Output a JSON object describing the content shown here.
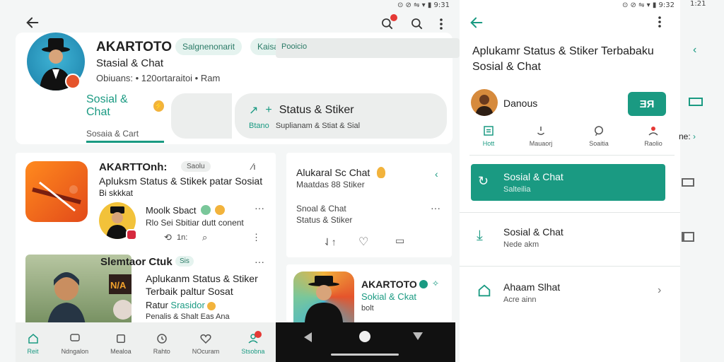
{
  "status_left": "⊙ ⊘ ⇋ ▾ ▮ 9:31",
  "status_right": "⊙ ⊘ ⇋ ▾ ▮ 9:32",
  "status_far": "1:21",
  "profile": {
    "name": "AKARTOTO",
    "category": "Stasial & Chat",
    "meta": "Obiuans: • 120ortaraitoi • Ram",
    "chip1": "Salgnenonarit",
    "chip2": "Kaisa",
    "chip3": "Pooicio"
  },
  "tabs": {
    "left_label": "Sosial & Chat",
    "left_sub": "Sosaia & Cart",
    "right_label": "Status & Stiker",
    "right_sub1": "Btano",
    "right_sub2": "Suplianam & Stiat & Sial"
  },
  "feed": {
    "item1_title": "AKARTTOnh:",
    "item1_chip": "Saolu",
    "item1_desc": "Apluksm Status & Stikek patar Sosiat",
    "item1_sub": "Bi skkkat",
    "item1_author": "Moolk Sbact",
    "item1_author_sub": "Rlo Sei Sbitiar dutt conent",
    "item1_reply": "1n:",
    "item2_title": "Slemtaor Ctuk",
    "item2_chip": "Sis",
    "item2_desc1": "Aplukanm Status & Stiker",
    "item2_desc2": "Terbaik paltur Sosat",
    "item2_tag": "Ratur",
    "item2_tag2": "Srasidor",
    "item2_foot": "Penalis & Shalt Eas Ana"
  },
  "mid_card": {
    "title": "Alukaral Sc Chat",
    "sub": "Maatdas 88 Stiker",
    "line1": "Snoal & Chat",
    "line2": "Status & Stiker"
  },
  "mid_card2": {
    "title": "AKARTOTO",
    "sub": "Sokial & Ckat",
    "note": "bolt"
  },
  "bottom_nav": [
    {
      "label": "Reit",
      "icon": "home-icon"
    },
    {
      "label": "Ndngalon",
      "icon": "chat-icon"
    },
    {
      "label": "Mealoa",
      "icon": "square-icon"
    },
    {
      "label": "Rahto",
      "icon": "clock-icon"
    },
    {
      "label": "NOcuram",
      "icon": "heart-icon"
    },
    {
      "label": "Stsobna",
      "icon": "person-icon"
    }
  ],
  "right": {
    "title": "Aplukamr Status & Stiker Terbabaku Sosial & Chat",
    "user": "Danous",
    "btn": "ƎЯ",
    "tabs": [
      {
        "label": "Hott",
        "icon": "list-icon"
      },
      {
        "label": "Mauaorj",
        "icon": "bell-icon"
      },
      {
        "label": "Soaitia",
        "icon": "chat-bubble-icon"
      },
      {
        "label": "Raolio",
        "icon": "person-icon"
      }
    ],
    "row1_title": "Sosial & Chat",
    "row1_sub": "Salteilia",
    "row2_title": "Sosial & Chat",
    "row2_sub": "Nede akm",
    "row3_title": "Ahaam Slhat",
    "row3_sub": "Acre ainn",
    "edge_label": "ne:"
  },
  "colors": {
    "accent": "#1a9a82",
    "badge": "#e53935"
  }
}
